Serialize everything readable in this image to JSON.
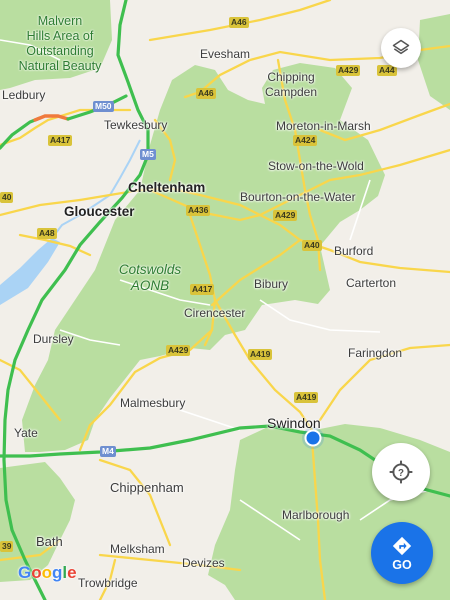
{
  "map": {
    "colors": {
      "land": "#f2efe9",
      "aonb": "#b9dea0",
      "motorway": "#3fbf4f",
      "motorway_congested": "#f07a3d",
      "a_road": "#f9d64b",
      "water": "#aad3f5",
      "location_dot": "#1a73e8"
    },
    "area_labels": [
      {
        "id": "malvern",
        "lines": [
          "Malvern",
          "Hills Area of",
          "Outstanding",
          "Natural Beauty"
        ]
      },
      {
        "id": "cotswolds",
        "lines": [
          "Cotswolds",
          "AONB"
        ]
      }
    ],
    "places": [
      {
        "id": "evesham",
        "name": "Evesham"
      },
      {
        "id": "chipping",
        "name": "Chipping\nCampden"
      },
      {
        "id": "ledbury",
        "name": "Ledbury"
      },
      {
        "id": "tewkesbury",
        "name": "Tewkesbury"
      },
      {
        "id": "moreton",
        "name": "Moreton-in-Marsh"
      },
      {
        "id": "stow",
        "name": "Stow-on-the-Wold"
      },
      {
        "id": "cheltenham",
        "name": "Cheltenham"
      },
      {
        "id": "bourton",
        "name": "Bourton-on-the-Water"
      },
      {
        "id": "gloucester",
        "name": "Gloucester"
      },
      {
        "id": "burford",
        "name": "Burford"
      },
      {
        "id": "bibury",
        "name": "Bibury"
      },
      {
        "id": "carterton",
        "name": "Carterton"
      },
      {
        "id": "cirencester",
        "name": "Cirencester"
      },
      {
        "id": "dursley",
        "name": "Dursley"
      },
      {
        "id": "faringdon",
        "name": "Faringdon"
      },
      {
        "id": "malmesbury",
        "name": "Malmesbury"
      },
      {
        "id": "swindon",
        "name": "Swindon"
      },
      {
        "id": "yate",
        "name": "Yate"
      },
      {
        "id": "chippenham",
        "name": "Chippenham"
      },
      {
        "id": "marlborough",
        "name": "Marlborough"
      },
      {
        "id": "bath",
        "name": "Bath"
      },
      {
        "id": "melksham",
        "name": "Melksham"
      },
      {
        "id": "devizes",
        "name": "Devizes"
      },
      {
        "id": "trowbridge",
        "name": "Trowbridge"
      }
    ],
    "road_shields": [
      {
        "id": "a46-n",
        "ref": "A46",
        "kind": "a"
      },
      {
        "id": "a429-ne",
        "ref": "A429",
        "kind": "a"
      },
      {
        "id": "a44",
        "ref": "A44",
        "kind": "a"
      },
      {
        "id": "a424",
        "ref": "A424",
        "kind": "a"
      },
      {
        "id": "a46-mid",
        "ref": "A46",
        "kind": "a"
      },
      {
        "id": "m50",
        "ref": "M50",
        "kind": "m"
      },
      {
        "id": "a417-w",
        "ref": "A417",
        "kind": "a"
      },
      {
        "id": "m5",
        "ref": "M5",
        "kind": "m"
      },
      {
        "id": "a436",
        "ref": "A436",
        "kind": "a"
      },
      {
        "id": "a429-mid",
        "ref": "A429",
        "kind": "a"
      },
      {
        "id": "a40-e",
        "ref": "A40",
        "kind": "a"
      },
      {
        "id": "a40-w",
        "ref": "40",
        "kind": "a"
      },
      {
        "id": "a48",
        "ref": "A48",
        "kind": "a"
      },
      {
        "id": "a417-c",
        "ref": "A417",
        "kind": "a"
      },
      {
        "id": "a429-s",
        "ref": "A429",
        "kind": "a"
      },
      {
        "id": "a419-n",
        "ref": "A419",
        "kind": "a"
      },
      {
        "id": "a419-s",
        "ref": "A419",
        "kind": "a"
      },
      {
        "id": "m4",
        "ref": "M4",
        "kind": "m"
      },
      {
        "id": "a39",
        "ref": "39",
        "kind": "a"
      }
    ]
  },
  "controls": {
    "layers_icon": "layers-icon",
    "locate_icon": "my-location-icon",
    "go_icon": "directions-icon",
    "go_label": "GO"
  },
  "attribution": {
    "logo": [
      "G",
      "o",
      "o",
      "g",
      "l",
      "e"
    ],
    "logo_colors": [
      "#4285f4",
      "#ea4335",
      "#fbbc05",
      "#4285f4",
      "#34a853",
      "#ea4335"
    ]
  }
}
